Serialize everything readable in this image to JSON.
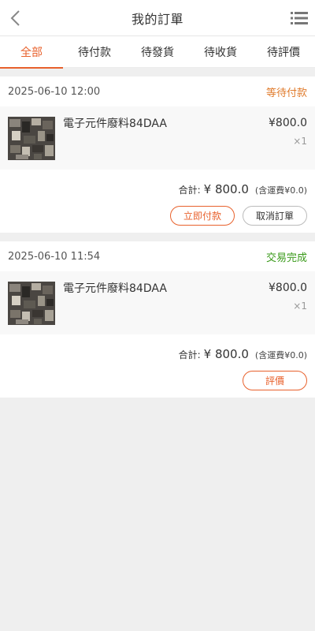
{
  "header": {
    "title": "我的訂單",
    "back_icon": "chevron-left-icon",
    "menu_icon": "list-menu-icon"
  },
  "tabs": [
    {
      "label": "全部",
      "active": true
    },
    {
      "label": "待付款",
      "active": false
    },
    {
      "label": "待發貨",
      "active": false
    },
    {
      "label": "待收貨",
      "active": false
    },
    {
      "label": "待評價",
      "active": false
    }
  ],
  "colors": {
    "accent": "#e8612c",
    "status_pending": "#e07b2c",
    "status_done": "#3a9a1a"
  },
  "orders": [
    {
      "date": "2025-06-10 12:00",
      "status": "等待付款",
      "product_name": "電子元件廢料84DAA",
      "price": "¥800.0",
      "quantity": "×1",
      "summary_label": "合計:",
      "summary_value": "¥ 800.0",
      "summary_shipping": "(含運費¥0.0)",
      "actions": [
        "立即付款",
        "取消訂單"
      ]
    },
    {
      "date": "2025-06-10 11:54",
      "status": "交易完成",
      "product_name": "電子元件廢料84DAA",
      "price": "¥800.0",
      "quantity": "×1",
      "summary_label": "合計:",
      "summary_value": "¥ 800.0",
      "summary_shipping": "(含運費¥0.0)",
      "actions": [
        "評價"
      ]
    }
  ]
}
